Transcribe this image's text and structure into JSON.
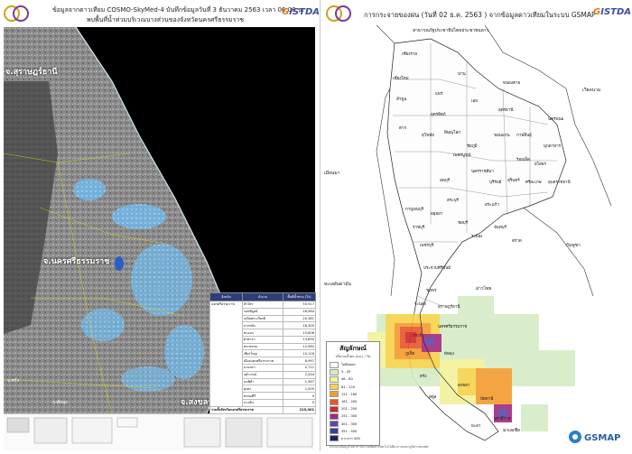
{
  "left": {
    "header": {
      "line1": "ข้อมูลจากดาวเทียม COSMO-SkyMed-4 บันทึกข้อมูลวันที่ 3 ธันวาคม 2563 เวลา 06.08 น.",
      "line2": "พบพื้นที่น้ำท่วมบริเวณบางส่วนของจังหวัดนครศรีธรรมราช"
    },
    "brand": "GISTDA",
    "place_labels": {
      "surat": "จ.สุราษฎร์ธานี",
      "nakhon": "จ.นครศรีธรรมราช",
      "songkhla": "จ.สงขลา",
      "trang": "จ.ตรัง",
      "phatthalung": "จ.พัทลุง"
    },
    "table": {
      "headers": [
        "จังหวัด",
        "อำเภอ",
        "พื้นที่น้ำท่วม (ไร่)"
      ],
      "province": "นครศรีธรรมราช",
      "rows": [
        {
          "district": "หัวไทร",
          "value": "55,917"
        },
        {
          "district": "ร่อนพิบูลย์",
          "value": "26,964"
        },
        {
          "district": "เฉลิมพระเกียรติ",
          "value": "20,381"
        },
        {
          "district": "ปากพนัง",
          "value": "16,305"
        },
        {
          "district": "ชะอวด",
          "value": "15,608"
        },
        {
          "district": "ท่าศาลา",
          "value": "13,890"
        },
        {
          "district": "พระพรหม",
          "value": "12,962"
        },
        {
          "district": "เชียรใหญ่",
          "value": "10,118"
        },
        {
          "district": "เมืองนครศรีธรรมราช",
          "value": "8,997"
        },
        {
          "district": "ลานสกา",
          "value": "2,711"
        },
        {
          "district": "จุฬาภรณ์",
          "value": "2,434"
        },
        {
          "district": "นบพิตำ",
          "value": "1,587"
        },
        {
          "district": "ทุ่งสง",
          "value": "1,005"
        },
        {
          "district": "พรหมคีรี",
          "value": "0"
        },
        {
          "district": "บางขัน",
          "value": "0"
        }
      ],
      "total_label": "รวมทั้งจังหวัดนครศรีธรรมราช",
      "total_value": "215,001"
    }
  },
  "right": {
    "header": {
      "title": "การกระจายของฝน (วันที่ 02 ธ.ค. 2563 ) จากข้อมูลดาวเทียมในระบบ GSMAP"
    },
    "brand": "GISTDA",
    "countries": {
      "laos": "สาธารณรัฐประชาธิปไตยประชาชนลาว",
      "vietnam": "เวียดนาม",
      "cambodia": "กัมพูชา",
      "andaman": "ทะเลอันดามัน",
      "gulf": "อ่าวไทย",
      "malaysia": "มาเลเซีย",
      "myanmar": "เมียนมา"
    },
    "legend": {
      "title": "สัญลักษณ์",
      "subtitle": "ปริมาณน้ำฝน (มม.) / วัน",
      "items": [
        {
          "label": "ไม่มีฝนตก",
          "color": "#ffffff"
        },
        {
          "label": "5 - 45",
          "color": "#d7ecc5"
        },
        {
          "label": "46 - 80",
          "color": "#f3f19a"
        },
        {
          "label": "81 - 120",
          "color": "#f6d24a"
        },
        {
          "label": "121 - 160",
          "color": "#f39b2f"
        },
        {
          "label": "161 - 200",
          "color": "#e8562a"
        },
        {
          "label": "201 - 250",
          "color": "#cf2a2a"
        },
        {
          "label": "251 - 300",
          "color": "#a12a80"
        },
        {
          "label": "301 - 350",
          "color": "#5a4aa8"
        },
        {
          "label": "351 - 400",
          "color": "#3a3f9a"
        },
        {
          "label": "มากกว่า 400",
          "color": "#1f1f6a"
        }
      ]
    },
    "credit": "ปรับปรุงข้อมูลโดย สำนักงานพัฒนาเทคโนโลยีอวกาศและภูมิสารสนเทศ",
    "gsmap": "GSMAP",
    "province_labels": [
      "เชียงราย",
      "เชียงใหม่",
      "ลำพูน",
      "น่าน",
      "แพร่",
      "อุตรดิตถ์",
      "ตาก",
      "สุโขทัย",
      "พิษณุโลก",
      "เพชรบูรณ์",
      "เลย",
      "หนองคาย",
      "อุดรธานี",
      "ขอนแก่น",
      "กาฬสินธุ์",
      "นครพนม",
      "มุกดาหาร",
      "ร้อยเอ็ด",
      "ยโสธร",
      "อุบลราชธานี",
      "ศรีสะเกษ",
      "สุรินทร์",
      "บุรีรัมย์",
      "นครราชสีมา",
      "ชัยภูมิ",
      "ลพบุรี",
      "สระบุรี",
      "อยุธยา",
      "สระแก้ว",
      "ชลบุรี",
      "ระยอง",
      "จันทบุรี",
      "ตราด",
      "กาญจนบุรี",
      "ราชบุรี",
      "เพชรบุรี",
      "ประจวบคีรีขันธ์",
      "ชุมพร",
      "ระนอง",
      "สุราษฎร์ธานี",
      "ภูเก็ต",
      "กระบี่",
      "นครศรีธรรมราช",
      "ตรัง",
      "พัทลุง",
      "สงขลา",
      "สตูล",
      "ปัตตานี",
      "ยะลา",
      "นราธิวาส"
    ]
  }
}
